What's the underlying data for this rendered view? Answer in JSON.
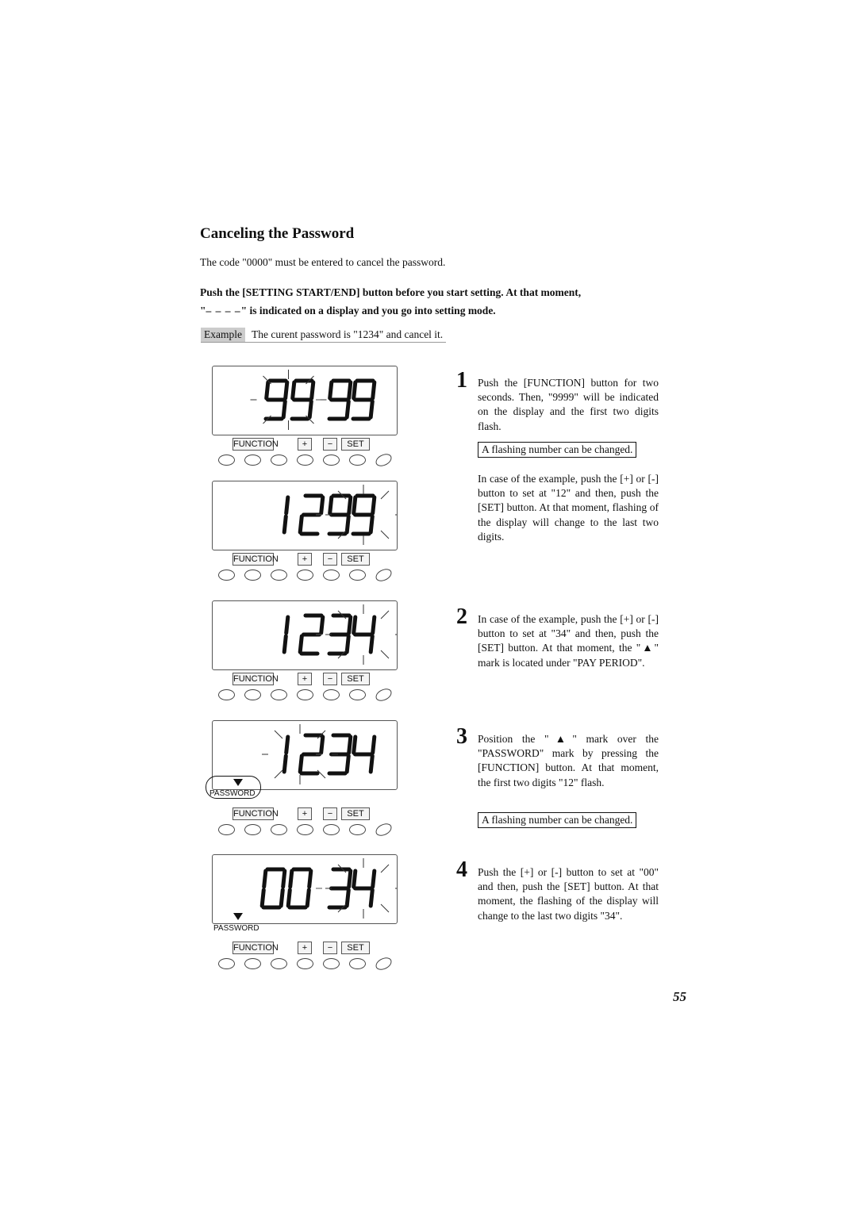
{
  "title": "Canceling the Password",
  "intro": "The code \"0000\" must be entered to cancel the password.",
  "instruction": {
    "part1": "Push the [SETTING START/END] button before you start setting.  At that moment,",
    "quote_open": "\"",
    "dashes": "– – – –",
    "quote_close": "\"",
    "part2": " is indicated on a display and you go into setting mode."
  },
  "example": {
    "tag": "Example",
    "text": "The curent password is \"1234\" and cancel it."
  },
  "panels": [
    {
      "display": "9999",
      "flashing": "first",
      "marker": "none"
    },
    {
      "display": "1299",
      "flashing": "last",
      "marker": "none"
    },
    {
      "display": "1234",
      "flashing": "last",
      "marker": "none"
    },
    {
      "display": "1234",
      "flashing": "first",
      "marker": "password-circled"
    },
    {
      "display": "0034",
      "flashing": "last",
      "marker": "password"
    }
  ],
  "buttons": {
    "function": "FUNCTION",
    "plus": "+",
    "minus": "−",
    "set": "SET"
  },
  "password_label": "PASSWORD",
  "steps": [
    {
      "num": "1",
      "text": "Push the [FUNCTION] button for two seconds. Then, \"9999\" will be indicated on the display and the first two digits flash.",
      "note": "A flashing number can be changed.",
      "extra": "In case of the example, push the [+] or [-] button to set at \"12\" and then, push the [SET] button. At that moment, flashing of the display will change to the last two digits."
    },
    {
      "num": "2",
      "text": "In case of the example, push the [+] or [-] button to set at \"34\" and then, push the [SET] button. At that moment, the \"▲\" mark is located under \"PAY PERIOD\"."
    },
    {
      "num": "3",
      "text": "Position the \"▲\" mark over the \"PASSWORD\" mark by pressing the [FUNCTION] button. At that moment, the first two digits \"12\" flash.",
      "note": "A flashing number can be changed."
    },
    {
      "num": "4",
      "text": "Push the [+] or [-] button to set at \"00\" and then, push the [SET] button. At that moment, the flashing of the display will change to the last two digits \"34\"."
    }
  ],
  "page_number": "55"
}
